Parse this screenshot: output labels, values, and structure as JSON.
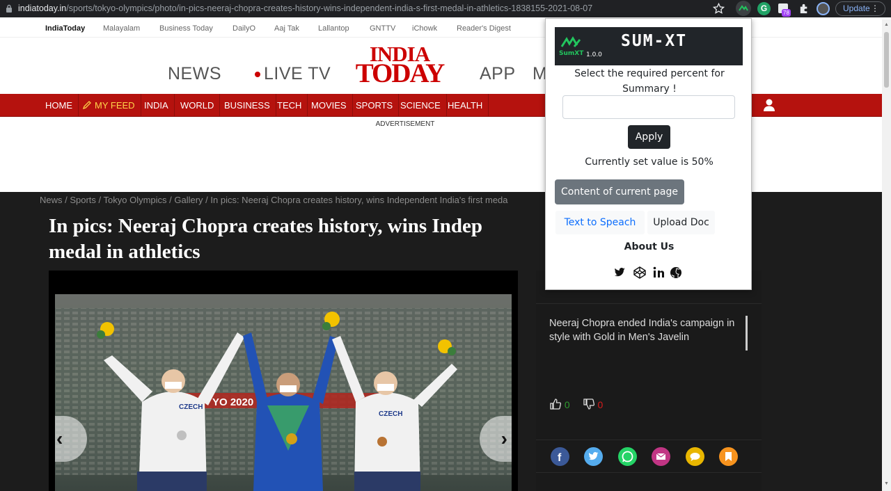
{
  "browser": {
    "url_domain": "indiatoday.in",
    "url_path": "/sports/tokyo-olympics/photo/in-pics-neeraj-chopra-creates-history-wins-independent-india-s-first-medal-in-athletics-1838155-2021-08-07",
    "extension_badge": "78",
    "update_label": "Update",
    "ext_letter": "G"
  },
  "sites_bar": [
    "IndiaToday",
    "Malayalam",
    "Business Today",
    "DailyO",
    "Aaj Tak",
    "Lallantop",
    "GNTTV",
    "iChowk",
    "Reader's Digest"
  ],
  "header": {
    "news_label": "NEWS",
    "live_tv_label": "LIVE TV",
    "logo_line1": "INDIA",
    "logo_line2": "TODAY",
    "app_label": "APP",
    "more_label": "M"
  },
  "nav": [
    "HOME",
    "MY FEED",
    "INDIA",
    "WORLD",
    "BUSINESS",
    "TECH",
    "MOVIES",
    "SPORTS",
    "SCIENCE",
    "HEALTH"
  ],
  "advertisement_label": "ADVERTISEMENT",
  "article": {
    "breadcrumb": "News / Sports / Tokyo Olympics / Gallery / In pics: Neeraj Chopra creates history, wins Independent India's first meda",
    "title": "In pics: Neeraj Chopra creates history, wins Indep medal in athletics",
    "title_line1": "In pics: Neeraj Chopra creates history, wins Indep",
    "title_line2": "medal in athletics",
    "photo_year_text": "YO 2020",
    "photo_jersey_text": "CZECH",
    "caption": "Neeraj Chopra ended India's campaign in style with Gold in Men's Javelin",
    "likes": "0",
    "dislikes": "0",
    "share_icons": [
      "facebook-icon",
      "twitter-icon",
      "whatsapp-icon",
      "email-icon",
      "comment-icon",
      "bookmark-icon"
    ],
    "colors": {
      "facebook": "#3b5998",
      "twitter": "#55acee",
      "whatsapp": "#25d366",
      "email": "#c13584",
      "comment": "#e8b600",
      "bookmark": "#f7931e"
    }
  },
  "popup": {
    "name": "SUM-XT",
    "brand_small": "SumXT",
    "version": "1.0.0",
    "prompt": "Select the required percent for Summary !",
    "input_value": "",
    "apply_label": "Apply",
    "current_value_text": "Currently set value is 50%",
    "content_button": "Content of current page",
    "tts_button": "Text to Speach",
    "upload_button": "Upload Doc",
    "about_us": "About Us",
    "social_icons": [
      "twitter-icon",
      "codepen-icon",
      "linkedin-icon",
      "github-icon"
    ]
  }
}
